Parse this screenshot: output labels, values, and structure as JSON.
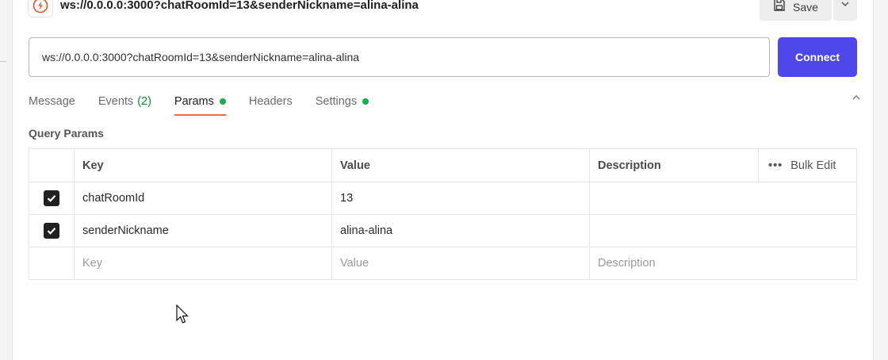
{
  "request": {
    "title": "ws://0.0.0.0:3000?chatRoomId=13&senderNickname=alina-alina",
    "url": "ws://0.0.0.0:3000?chatRoomId=13&senderNickname=alina-alina",
    "icon": "websocket-icon"
  },
  "toolbar": {
    "save_label": "Save",
    "save_icon": "save-icon",
    "menu_icon": "chevron-down-icon",
    "connect_label": "Connect"
  },
  "tabs": [
    {
      "label": "Message"
    },
    {
      "label": "Events",
      "count": "(2)"
    },
    {
      "label": "Params",
      "indicator": true,
      "active": true
    },
    {
      "label": "Headers"
    },
    {
      "label": "Settings",
      "indicator": true
    }
  ],
  "params": {
    "section_title": "Query Params",
    "columns": {
      "key": "Key",
      "value": "Value",
      "description": "Description"
    },
    "bulk_edit_label": "Bulk Edit",
    "more_label": "•••",
    "rows": [
      {
        "enabled": true,
        "key": "chatRoomId",
        "value": "13",
        "description": ""
      },
      {
        "enabled": true,
        "key": "senderNickname",
        "value": "alina-alina",
        "description": ""
      }
    ],
    "placeholders": {
      "key": "Key",
      "value": "Value",
      "description": "Description"
    }
  },
  "colors": {
    "accent": "#4e48ea",
    "active_tab_underline": "#ff6c37",
    "indicator": "#10b34a",
    "events_count": "#0f8a3b"
  }
}
